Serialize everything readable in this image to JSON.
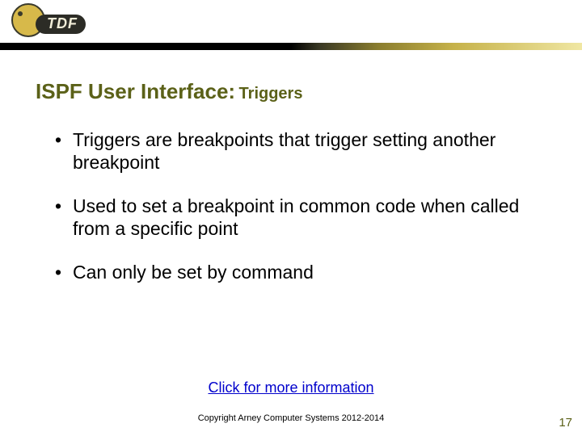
{
  "header": {
    "logo_text": "TDF"
  },
  "title": {
    "main": "ISPF User Interface:",
    "sub": "Triggers"
  },
  "bullets": [
    "Triggers are breakpoints that trigger setting another breakpoint",
    "Used to set a breakpoint in common code when called from a specific point",
    "Can only be set by command"
  ],
  "link_text": "Click for more information",
  "copyright": "Copyright Arney Computer Systems 2012-2014",
  "page_number": "17"
}
